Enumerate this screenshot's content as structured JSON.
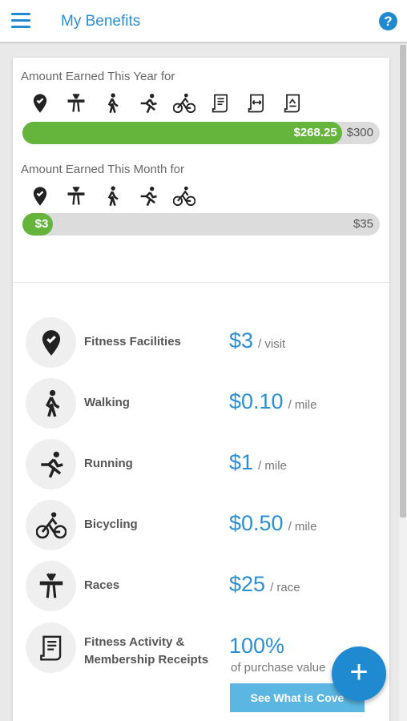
{
  "header": {
    "title": "My Benefits",
    "menu_icon": "hamburger-menu-icon",
    "help_icon": "help-icon",
    "help_glyph": "?"
  },
  "year": {
    "label": "Amount Earned This Year for",
    "icons": [
      "location-pin-icon",
      "race-finish-icon",
      "walking-icon",
      "running-icon",
      "bicycling-icon",
      "receipt-scroll-icon",
      "membership-card-icon",
      "document-icon"
    ],
    "earned": "$268.25",
    "max": "$300",
    "progress": 0.894
  },
  "month": {
    "label": "Amount Earned This Month for",
    "icons": [
      "location-pin-icon",
      "race-finish-icon",
      "walking-icon",
      "running-icon",
      "bicycling-icon"
    ],
    "earned": "$3",
    "max": "$35",
    "progress": 0.086
  },
  "benefits": [
    {
      "name": "Fitness Facilities",
      "price": "$3",
      "unit": "/ visit",
      "icon": "location-pin-icon"
    },
    {
      "name": "Walking",
      "price": "$0.10",
      "unit": "/ mile",
      "icon": "walking-icon"
    },
    {
      "name": "Running",
      "price": "$1",
      "unit": "/ mile",
      "icon": "running-icon"
    },
    {
      "name": "Bicycling",
      "price": "$0.50",
      "unit": "/ mile",
      "icon": "bicycling-icon"
    },
    {
      "name": "Races",
      "price": "$25",
      "unit": "/ race",
      "icon": "race-finish-icon"
    },
    {
      "name": "Fitness Activity & Membership Receipts",
      "price": "100%",
      "sub": "of purchase value",
      "button": "See What is Cove",
      "icon": "receipt-icon"
    }
  ],
  "fab": {
    "label": "+",
    "icon": "add-icon"
  },
  "colors": {
    "accent": "#1f8ad0",
    "progress": "#65b43c",
    "track": "#dcdcdc",
    "button": "#5bb7e2"
  }
}
